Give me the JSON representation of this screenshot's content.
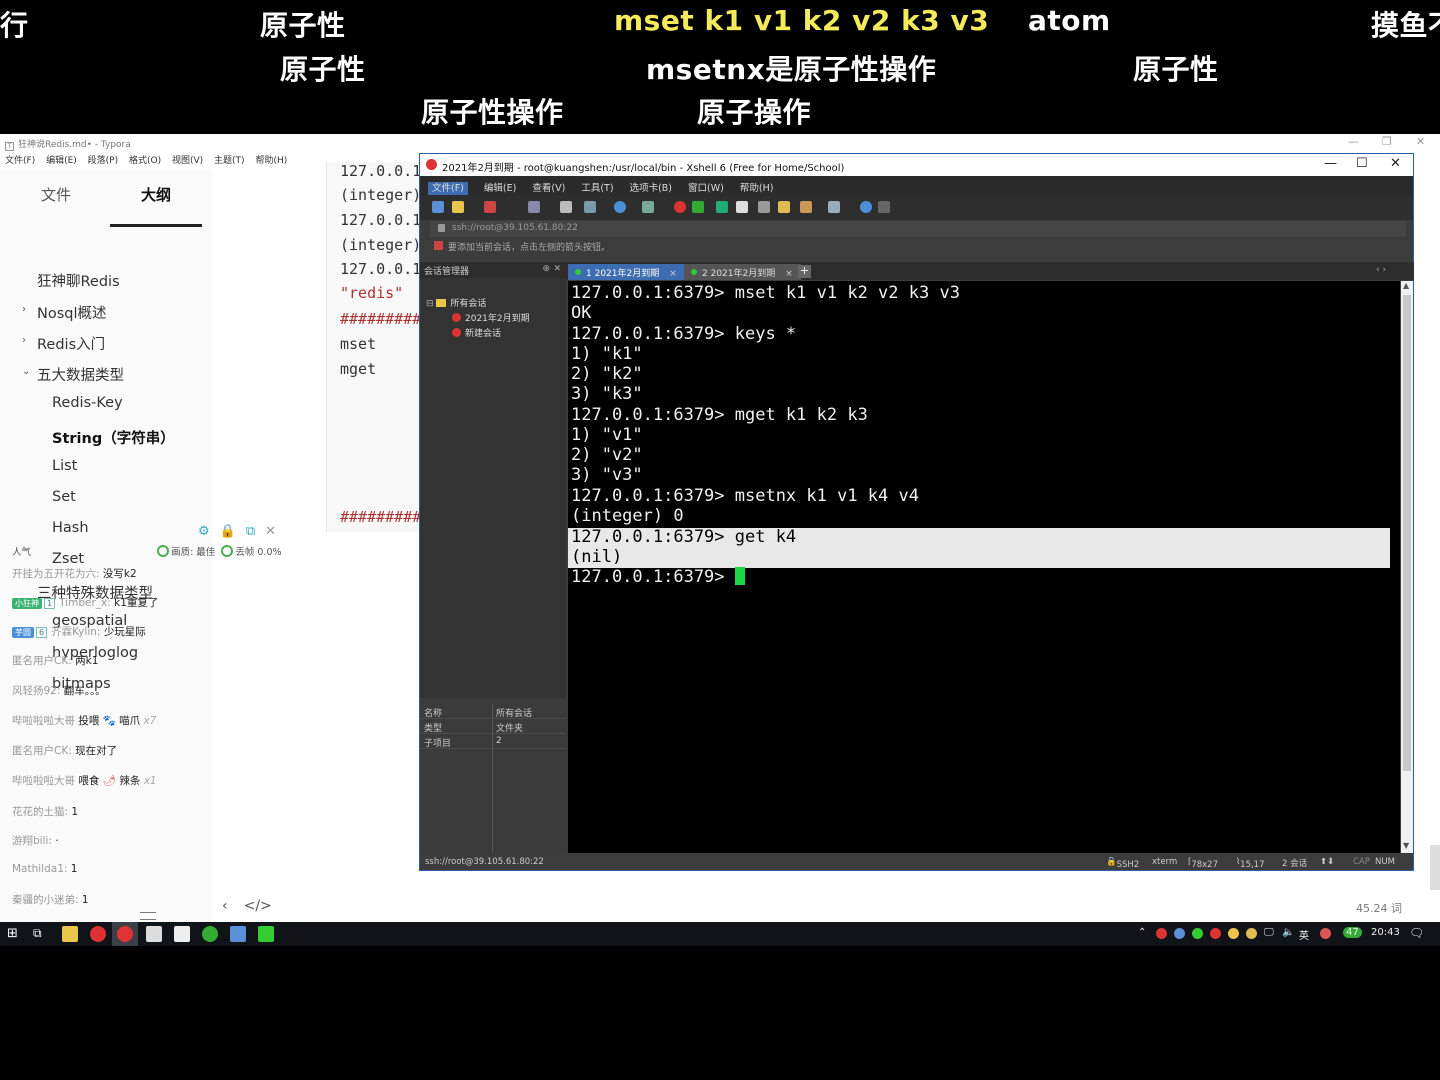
{
  "danmaku": [
    {
      "text": "行",
      "color": "white"
    },
    {
      "text": "原子性",
      "color": "white"
    },
    {
      "text": "mset k1 v1 k2 v2 k3 v3",
      "color": "yellow"
    },
    {
      "text": "atom",
      "color": "white"
    },
    {
      "text": "摸鱼不",
      "color": "white"
    },
    {
      "text": "原子性",
      "color": "white"
    },
    {
      "text": "msetnx是原子性操作",
      "color": "white"
    },
    {
      "text": "原子性",
      "color": "white"
    },
    {
      "text": "原子性操作",
      "color": "white"
    },
    {
      "text": "原子操作",
      "color": "white"
    }
  ],
  "typora": {
    "title": "狂神说Redis.md• - Typora",
    "menu": [
      "文件(F)",
      "编辑(E)",
      "段落(P)",
      "格式(O)",
      "视图(V)",
      "主题(T)",
      "帮助(H)"
    ],
    "tabs": {
      "files": "文件",
      "outline": "大纲"
    },
    "outline": [
      {
        "label": "狂神聊Redis"
      },
      {
        "label": "Nosql概述"
      },
      {
        "label": "Redis入门"
      },
      {
        "label": "五大数据类型"
      },
      {
        "label": "Redis-Key"
      },
      {
        "label": "String（字符串）"
      },
      {
        "label": "List"
      },
      {
        "label": "Set"
      },
      {
        "label": "Hash"
      },
      {
        "label": "Zset"
      },
      {
        "label": "三种特殊数据类型"
      },
      {
        "label": "geospatial"
      },
      {
        "label": "hyperloglog"
      },
      {
        "label": "bitmaps"
      }
    ],
    "code": [
      "127.0.0.1",
      "(integer)",
      "127.0.0.1",
      "(integer)",
      "127.0.0.1",
      "\"redis\"",
      "#########",
      "mset",
      "mget",
      "#########"
    ],
    "word_count": "45.24 词"
  },
  "chat": {
    "stats": {
      "popularity": "人气",
      "quality_label": "画质: 最佳",
      "drop_label": "丢帧 0.0%"
    },
    "messages": [
      {
        "user": "开挂为五开花为六:",
        "text": "没写k2"
      },
      {
        "badge": "小狂神",
        "badge_color": "#3cb371",
        "level": "1",
        "user": "Timber_x:",
        "text": "k1重复了"
      },
      {
        "badge": "芋圆",
        "badge_color": "#4a90d9",
        "level": "6",
        "user": "齐霖Kylin:",
        "text": "少玩星际"
      },
      {
        "user": "匿名用户CK:",
        "text": "两k1"
      },
      {
        "user": "风轻扬92:",
        "text": "翻车。。。"
      },
      {
        "user": "哔啦啦啦大哥",
        "text": "投喂",
        "gift": "喵爪",
        "gift_count": "x7"
      },
      {
        "user": "匿名用户CK:",
        "text": "现在对了"
      },
      {
        "user": "哔啦啦啦大哥",
        "text": "喂食",
        "gift": "辣条",
        "gift_count": "x1"
      },
      {
        "user": "花花的土猫:",
        "text": "1"
      },
      {
        "user": "游翔bili:",
        "text": "·"
      },
      {
        "user": "Mathilda1:",
        "text": "1"
      },
      {
        "user": "秦疆的小迷弟:",
        "text": "1"
      }
    ]
  },
  "xshell": {
    "title": "2021年2月到期 - root@kuangshen:/usr/local/bin - Xshell 6 (Free for Home/School)",
    "menu": [
      "文件(F)",
      "编辑(E)",
      "查看(V)",
      "工具(T)",
      "选项卡(B)",
      "窗口(W)",
      "帮助(H)"
    ],
    "address": "ssh://root@39.105.61.80:22",
    "hint": "要添加当前会话，点击左侧的箭头按钮。",
    "session_panel": {
      "title": "会话管理器",
      "root": "所有会话",
      "items": [
        "2021年2月到期",
        "新建会话"
      ],
      "props": [
        {
          "key": "名称",
          "value": "所有会话"
        },
        {
          "key": "类型",
          "value": "文件夹"
        },
        {
          "key": "子项目",
          "value": "2"
        }
      ]
    },
    "tabs": [
      {
        "label": "1 2021年2月到期",
        "active": true
      },
      {
        "label": "2 2021年2月到期",
        "active": false
      }
    ],
    "terminal": [
      "127.0.0.1:6379> mset k1 v1 k2 v2 k3 v3",
      "OK",
      "127.0.0.1:6379> keys *",
      "1) \"k1\"",
      "2) \"k2\"",
      "3) \"k3\"",
      "127.0.0.1:6379> mget k1 k2 k3",
      "1) \"v1\"",
      "2) \"v2\"",
      "3) \"v3\"",
      "127.0.0.1:6379> msetnx k1 v1 k4 v4",
      "(integer) 0",
      "127.0.0.1:6379> get k4",
      "(nil)",
      "127.0.0.1:6379> "
    ],
    "status": {
      "connection": "ssh://root@39.105.61.80:22",
      "protocol": "SSH2",
      "term": "xterm",
      "size": "78x27",
      "pos": "15,17",
      "sessions": "2 会话",
      "caps": "CAP",
      "num": "NUM"
    }
  },
  "taskbar": {
    "clock": "20:43",
    "ime": "英",
    "badge": "47"
  }
}
